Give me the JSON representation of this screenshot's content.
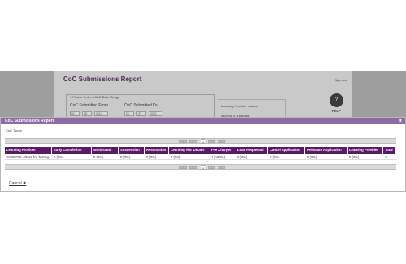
{
  "background_page": {
    "title": "CoC Submissions Report",
    "sign_out": "Sign out",
    "fieldset_legend": "1.Please Enter a CoC Date Range",
    "submitted_from_label": "CoC Submitted From",
    "submitted_to_label": "CoC Submitted To",
    "from_date": {
      "day": "01",
      "month": "08",
      "year": "2015"
    },
    "to_date": {
      "day": "01",
      "month": "07",
      "year": "2021"
    },
    "lookup_label": "Learning Provider Lookup",
    "ukprn_label": "UKPRN or Learning",
    "help_label": "HELP"
  },
  "modal": {
    "title": "CoC Submissions Report",
    "close_icon": "close-icon",
    "section_label": "CoC Types",
    "pager": {
      "first": "<<",
      "prev": "<",
      "page": "1",
      "next": ">",
      "last": ">>"
    },
    "columns": [
      "Learning Provider",
      "Early Completion",
      "Withdrawal",
      "Suspension",
      "Resumption",
      "Learning Aim Details",
      "Fee Charged",
      "Loan Requested",
      "Cancel Application",
      "Reinstate Application",
      "Learning Provider",
      "Total"
    ],
    "rows": [
      [
        "10498798 - Ross for Testing",
        "0 (0%)",
        "0 (0%)",
        "0 (0%)",
        "0 (0%)",
        "0 (0%)",
        "1 (100%)",
        "0 (0%)",
        "0 (0%)",
        "0 (0%)",
        "0 (0%)",
        "1"
      ]
    ],
    "cancel_label": "Cancel ✖"
  },
  "colors": {
    "modal_header": "#8e6ba4",
    "grid_header": "#5b1a66",
    "title_text": "#4a2a55"
  }
}
